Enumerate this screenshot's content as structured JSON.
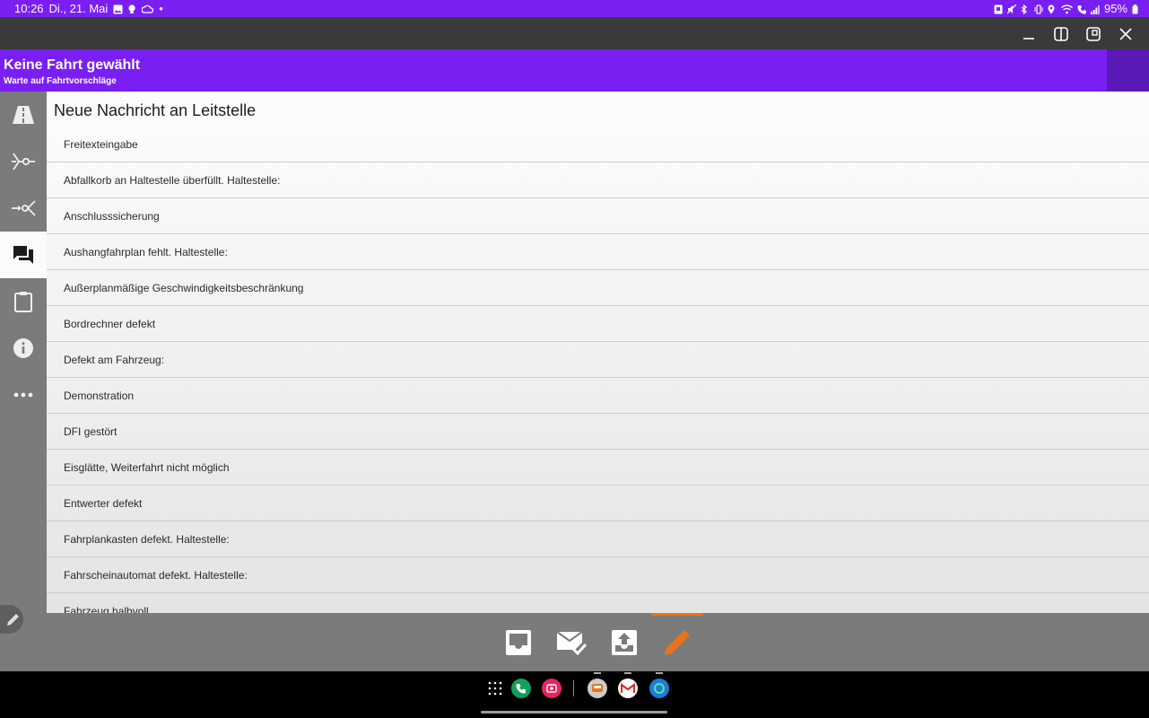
{
  "status_bar": {
    "time": "10:26",
    "date": "Di., 21. Mai",
    "dot": "•",
    "battery": "95%"
  },
  "header": {
    "title": "Keine Fahrt gewählt",
    "subtitle": "Warte auf Fahrtvorschläge"
  },
  "sidebar": {
    "items": [
      "road-icon",
      "route-split-icon",
      "route-merge-icon",
      "chat-icon",
      "clipboard-icon",
      "info-icon",
      "more-icon"
    ],
    "active_index": 3
  },
  "main": {
    "heading": "Neue Nachricht an Leitstelle",
    "items": [
      "Freitexteingabe",
      "Abfallkorb an Haltestelle überfüllt. Haltestelle:",
      "Anschlusssicherung",
      "Aushangfahrplan fehlt. Haltestelle:",
      "Außerplanmäßige Geschwindigkeitsbeschränkung",
      "Bordrechner defekt",
      "Defekt am Fahrzeug:",
      "Demonstration",
      "DFI gestört",
      "Eisglätte, Weiterfahrt nicht möglich",
      "Entwerter defekt",
      "Fahrplankasten defekt. Haltestelle:",
      "Fahrscheinautomat defekt. Haltestelle:",
      "Fahrzeug halbvoll"
    ]
  },
  "bottom_tabs": {
    "items": [
      "inbox-icon",
      "mail-check-icon",
      "outbox-upload-icon",
      "pencil-icon"
    ],
    "active_index": 3
  },
  "colors": {
    "primary": "#7a1ff2",
    "primary_dark": "#5a19b6",
    "sidebar": "#7b7b7b",
    "accent": "#e8731b"
  }
}
